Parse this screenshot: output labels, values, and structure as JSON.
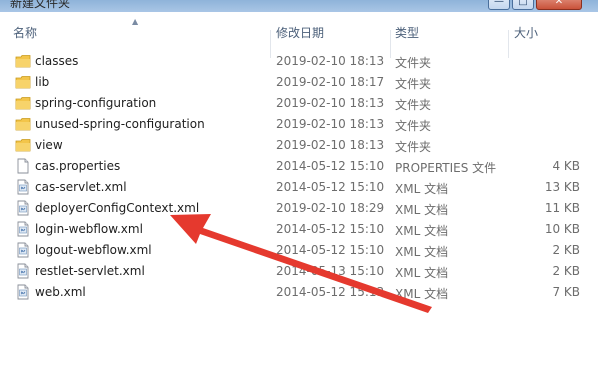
{
  "window": {
    "title": "新建文件夹",
    "min_glyph": "—",
    "max_glyph": "□",
    "close_glyph": "✕"
  },
  "columns": {
    "name": "名称",
    "date": "修改日期",
    "type": "类型",
    "size": "大小"
  },
  "files": [
    {
      "icon": "folder-icon",
      "name": "classes",
      "date": "2019-02-10 18:13",
      "type": "文件夹",
      "size": ""
    },
    {
      "icon": "folder-icon",
      "name": "lib",
      "date": "2019-02-10 18:17",
      "type": "文件夹",
      "size": ""
    },
    {
      "icon": "folder-icon",
      "name": "spring-configuration",
      "date": "2019-02-10 18:13",
      "type": "文件夹",
      "size": ""
    },
    {
      "icon": "folder-icon",
      "name": "unused-spring-configuration",
      "date": "2019-02-10 18:13",
      "type": "文件夹",
      "size": ""
    },
    {
      "icon": "folder-icon",
      "name": "view",
      "date": "2019-02-10 18:13",
      "type": "文件夹",
      "size": ""
    },
    {
      "icon": "document-icon",
      "name": "cas.properties",
      "date": "2014-05-12 15:10",
      "type": "PROPERTIES 文件",
      "size": "4 KB"
    },
    {
      "icon": "xml-file-icon",
      "name": "cas-servlet.xml",
      "date": "2014-05-12 15:10",
      "type": "XML 文档",
      "size": "13 KB"
    },
    {
      "icon": "xml-file-icon",
      "name": "deployerConfigContext.xml",
      "date": "2019-02-10 18:29",
      "type": "XML 文档",
      "size": "11 KB"
    },
    {
      "icon": "xml-file-icon",
      "name": "login-webflow.xml",
      "date": "2014-05-12 15:10",
      "type": "XML 文档",
      "size": "10 KB"
    },
    {
      "icon": "xml-file-icon",
      "name": "logout-webflow.xml",
      "date": "2014-05-12 15:10",
      "type": "XML 文档",
      "size": "2 KB"
    },
    {
      "icon": "xml-file-icon",
      "name": "restlet-servlet.xml",
      "date": "2014-05-13 15:10",
      "type": "XML 文档",
      "size": "2 KB"
    },
    {
      "icon": "xml-file-icon",
      "name": "web.xml",
      "date": "2014-05-12 15:13",
      "type": "XML 文档",
      "size": "7 KB"
    }
  ],
  "colors": {
    "folder": "#f3c54a",
    "annotation_arrow": "#e5392e",
    "header_text": "#4c607a",
    "meta_text": "#6d6d6d"
  }
}
